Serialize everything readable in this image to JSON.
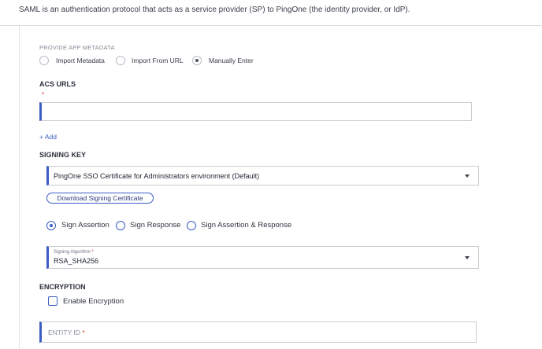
{
  "intro_text": "SAML is an authentication protocol that acts as a service provider (SP) to PingOne (the identity provider, or IdP).",
  "metadata": {
    "label": "PROVIDE APP METADATA",
    "options": [
      "Import Metadata",
      "Import From URL",
      "Manually Enter"
    ],
    "selected": "Manually Enter"
  },
  "acs": {
    "label": "ACS URLS",
    "required_mark": "*",
    "value": "",
    "add_label": "+ Add"
  },
  "signing_key": {
    "label": "SIGNING KEY",
    "selected": "PingOne SSO Certificate for Administrators environment (Default)",
    "download_label": "Download Signing Certificate"
  },
  "sign_options": {
    "options": [
      "Sign Assertion",
      "Sign Response",
      "Sign Assertion & Response"
    ],
    "selected": "Sign Assertion"
  },
  "signing_algorithm": {
    "label": "Signing Algorithm",
    "required_mark": "*",
    "value": "RSA_SHA256"
  },
  "encryption": {
    "label": "ENCRYPTION",
    "checkbox_label": "Enable Encryption",
    "checked": false
  },
  "entity_id": {
    "placeholder": "ENTITY ID",
    "required_mark": "*"
  },
  "colors": {
    "accent": "#3b5dc4",
    "required": "#d0312d"
  }
}
